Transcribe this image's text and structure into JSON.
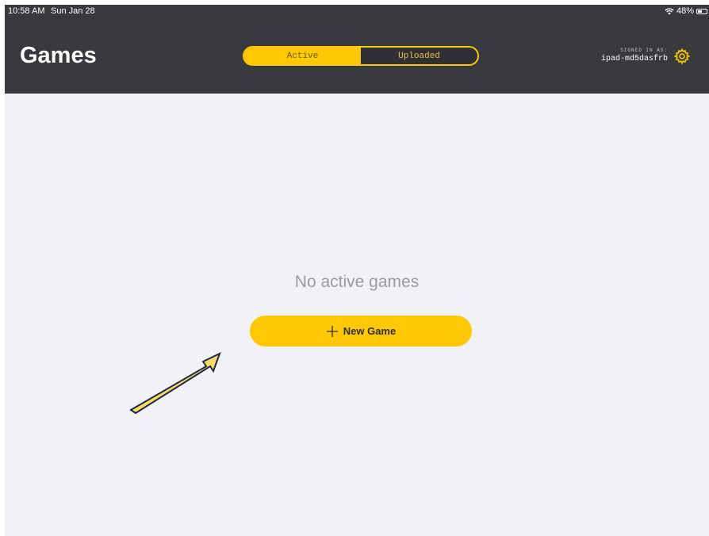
{
  "status_bar": {
    "time": "10:58 AM",
    "date": "Sun Jan 28",
    "battery": "48%",
    "battery_level": 0.48,
    "icons": [
      "wifi-icon",
      "battery-icon"
    ]
  },
  "header": {
    "title": "Games",
    "tabs": [
      {
        "label": "Active",
        "selected": true
      },
      {
        "label": "Uploaded",
        "selected": false
      }
    ],
    "signed_in_label": "SIGNED IN AS:",
    "username": "ipad-md5dasfrb",
    "settings_icon": "gear-icon"
  },
  "main": {
    "empty_message": "No active games",
    "new_game_label": "New Game",
    "new_game_icon": "plus-icon"
  },
  "colors": {
    "accent": "#ffc805",
    "header_bg": "#38393d",
    "page_bg": "#f1f1f6",
    "annotation_arrow": "#fbd86a"
  }
}
